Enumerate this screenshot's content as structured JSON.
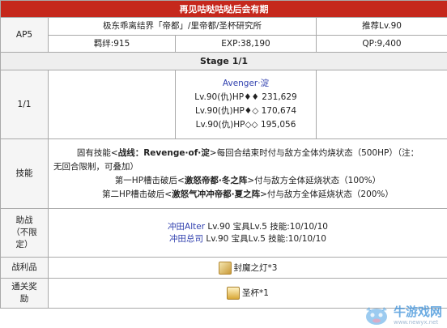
{
  "title": "再见咕哒咕哒后会有期",
  "ap": {
    "label": "AP5",
    "location": "极东乖离结界「帝都」/里帝都/圣杯研究所",
    "recommended": "推荐Lv.90"
  },
  "rewards_row": {
    "bond": "羁绊:915",
    "exp": "EXP:38,190",
    "qp": "QP:9,400"
  },
  "stage": "Stage 1/1",
  "wave": {
    "label": "1/1",
    "enemy_name": "Avenger·淀",
    "hp_lines": [
      "Lv.90(仇)HP♦♦ 231,629",
      "Lv.90(仇)HP♦◇ 170,674",
      "Lv.90(仇)HP◇◇ 195,056"
    ]
  },
  "skills": {
    "label": "技能",
    "line1_pre": "固有技能<",
    "line1_bold": "战线：Revenge·of·淀",
    "line1_post": ">每回合结束时付与敌方全体灼烧状态（500HP）（注：",
    "line1b": "无回合限制，可叠加）",
    "line2_pre": "第一HP槽击破后<",
    "line2_bold": "激怒帝都·冬之阵",
    "line2_post": ">付与敌方全体延烧状态（100%）",
    "line3_pre": "第二HP槽击破后<",
    "line3_bold": "激怒气冲冲帝都·夏之阵",
    "line3_post": ">付与敌方全体延烧状态（200%）"
  },
  "support": {
    "label_lines": [
      "助战",
      "（不限",
      "定）"
    ],
    "rows": [
      {
        "name": "冲田Alter",
        "detail": " Lv.90 宝具Lv.5 技能:10/10/10"
      },
      {
        "name": "冲田总司",
        "detail": " Lv.90 宝具Lv.5 技能:10/10/10"
      }
    ]
  },
  "drops": {
    "label": "战利品",
    "item": "封魔之灯*3",
    "icon": "lamp-icon"
  },
  "clear": {
    "label_lines": [
      "通关奖",
      "励"
    ],
    "item": "圣杯*1",
    "icon": "holy-grail-icon"
  },
  "watermark": {
    "name": "牛游戏网",
    "url": "www.newyx.net",
    "icon": "cow-mascot-icon"
  },
  "colors": {
    "title_bg": "#c5281c",
    "link": "#2f3fae",
    "border": "#a9a9a9",
    "header_gray": "#eeeeee"
  }
}
